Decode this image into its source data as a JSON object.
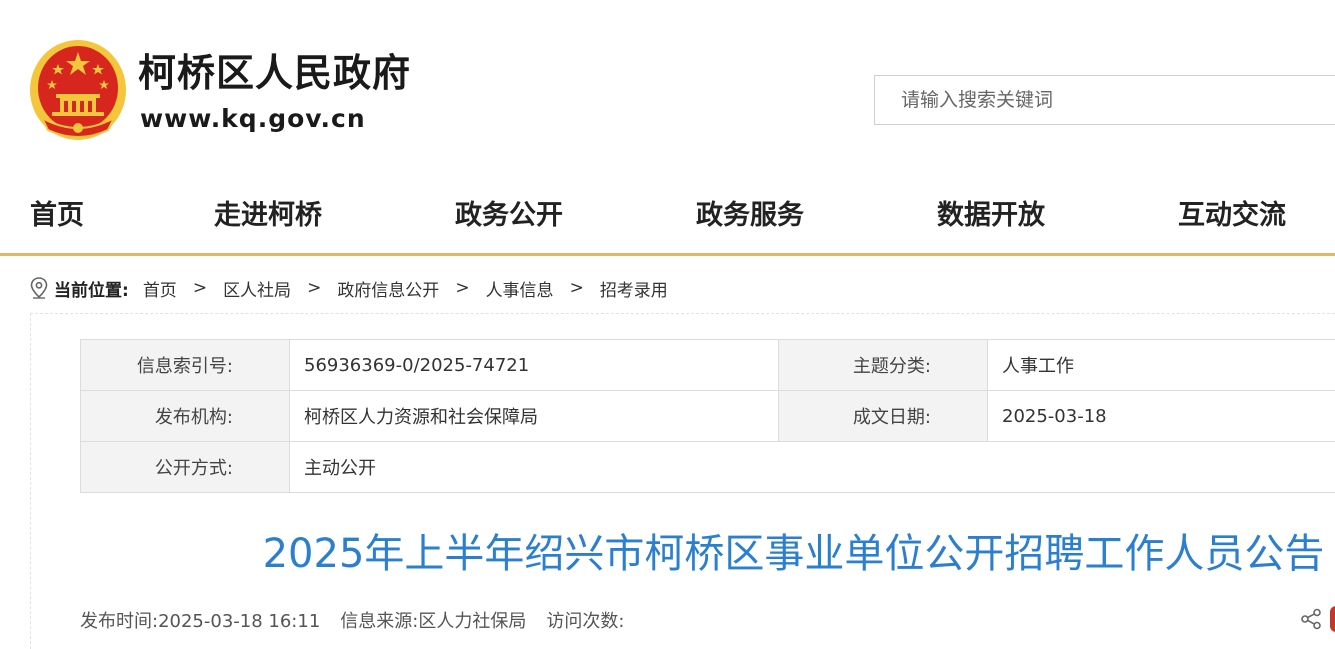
{
  "header": {
    "site_name": "柯桥区人民政府",
    "site_url": "www.kq.gov.cn",
    "search_placeholder": "请输入搜索关键词"
  },
  "nav": {
    "items": [
      {
        "label": "首页"
      },
      {
        "label": "走进柯桥"
      },
      {
        "label": "政务公开"
      },
      {
        "label": "政务服务"
      },
      {
        "label": "数据开放"
      },
      {
        "label": "互动交流"
      }
    ]
  },
  "breadcrumb": {
    "label": "当前位置:",
    "separator": ">",
    "items": [
      "首页",
      "区人社局",
      "政府信息公开",
      "人事信息",
      "招考录用"
    ]
  },
  "meta": {
    "index_label": "信息索引号:",
    "index_value": "56936369-0/2025-74721",
    "topic_label": "主题分类:",
    "topic_value": "人事工作",
    "org_label": "发布机构:",
    "org_value": "柯桥区人力资源和社会保障局",
    "date_label": "成文日期:",
    "date_value": "2025-03-18",
    "method_label": "公开方式:",
    "method_value": "主动公开"
  },
  "article": {
    "title": "2025年上半年绍兴市柯桥区事业单位公开招聘工作人员公告",
    "publish_time": "发布时间:2025-03-18 16:11",
    "source": "信息来源:区人力社保局",
    "visits": "访问次数:"
  },
  "colors": {
    "accent_gold": "#e0b866",
    "title_blue": "#2b7fcf",
    "emblem_red": "#d7261e",
    "emblem_gold": "#f3c63c"
  }
}
